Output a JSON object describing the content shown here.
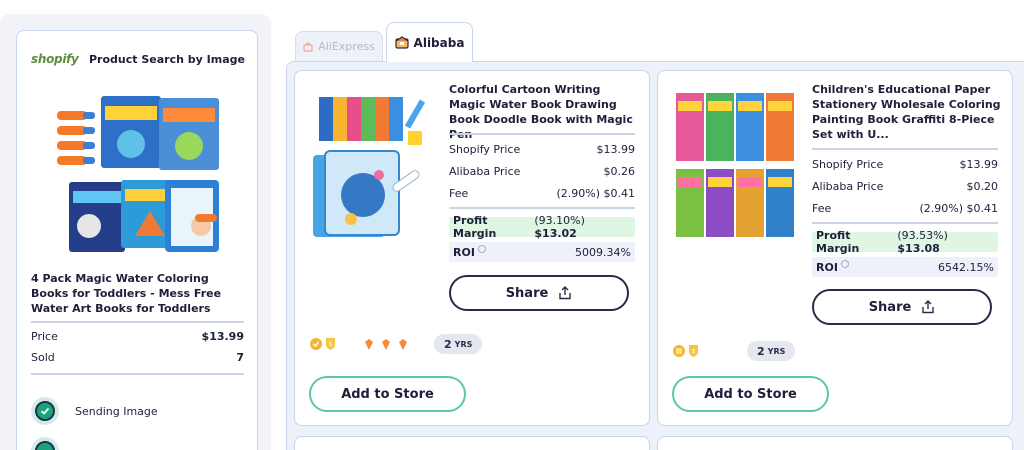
{
  "left": {
    "logo_text": "shopify",
    "title": "Product Search by Image",
    "product_name": "4 Pack Magic Water Coloring Books for Toddlers - Mess Free Water Art Books for Toddlers",
    "price_label": "Price",
    "price_value": "$13.99",
    "sold_label": "Sold",
    "sold_value": "7",
    "steps": [
      {
        "label": "Sending Image",
        "status": "done"
      },
      {
        "label": "",
        "status": "done"
      }
    ]
  },
  "tabs": [
    {
      "label": "AliExpress",
      "icon": "aliexpress-icon",
      "active": false
    },
    {
      "label": "Alibaba",
      "icon": "alibaba-icon",
      "active": true
    }
  ],
  "cards": [
    {
      "title": "Colorful Cartoon Writing Magic Water Book Drawing Book Doodle Book with Magic Pen",
      "shopify_price_label": "Shopify Price",
      "shopify_price": "$13.99",
      "alibaba_price_label": "Alibaba Price",
      "alibaba_price": "$0.26",
      "fee_label": "Fee",
      "fee_pct": "(2.90%)",
      "fee_value": "$0.41",
      "profit_label": "Profit Margin",
      "profit_pct": "(93.10%)",
      "profit_value": "$13.02",
      "roi_label": "ROI",
      "roi_value": "5009.34%",
      "share_label": "Share",
      "years": "2",
      "years_unit": "YRS",
      "add_label": "Add to Store"
    },
    {
      "title": "Children's Educational Paper Stationery Wholesale Coloring Painting Book Graffiti 8-Piece Set with U...",
      "shopify_price_label": "Shopify Price",
      "shopify_price": "$13.99",
      "alibaba_price_label": "Alibaba Price",
      "alibaba_price": "$0.20",
      "fee_label": "Fee",
      "fee_pct": "(2.90%)",
      "fee_value": "$0.41",
      "profit_label": "Profit Margin",
      "profit_pct": "(93.53%)",
      "profit_value": "$13.08",
      "roi_label": "ROI",
      "roi_value": "6542.15%",
      "share_label": "Share",
      "years": "2",
      "years_unit": "YRS",
      "add_label": "Add to Store"
    }
  ],
  "colors": {
    "accent_green": "#1aa37c",
    "profit_bg": "#dff6e2",
    "navy": "#1e1f3b",
    "add_border": "#5cc7a8"
  }
}
